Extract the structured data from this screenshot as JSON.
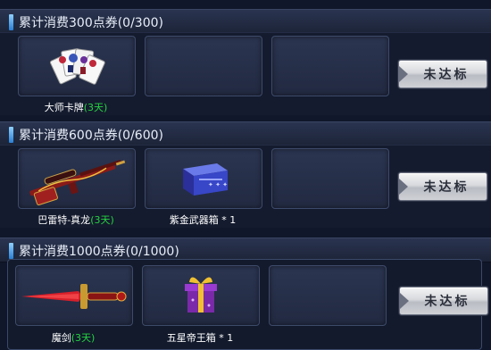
{
  "tiers": [
    {
      "title": "累计消费300点券(0/300)",
      "status": "未达标",
      "items": [
        {
          "name": "大师卡牌",
          "duration": "(3天)",
          "icon": "playing-cards-icon"
        }
      ]
    },
    {
      "title": "累计消费600点券(0/600)",
      "status": "未达标",
      "items": [
        {
          "name": "巴雷特-真龙",
          "duration": "(3天)",
          "icon": "sniper-rifle-icon"
        },
        {
          "name": "紫金武器箱 * 1",
          "duration": "",
          "icon": "weapon-case-icon"
        }
      ]
    },
    {
      "title": "累计消费1000点券(0/1000)",
      "status": "未达标",
      "items": [
        {
          "name": "魔剑",
          "duration": "(3天)",
          "icon": "sword-icon"
        },
        {
          "name": "五星帝王箱 * 1",
          "duration": "",
          "icon": "gift-box-icon"
        }
      ]
    }
  ],
  "colors": {
    "background": "#10172a",
    "duration_text": "#25d340",
    "accent_marker": "#4aa8ff",
    "button_text": "#2b2f3a"
  }
}
